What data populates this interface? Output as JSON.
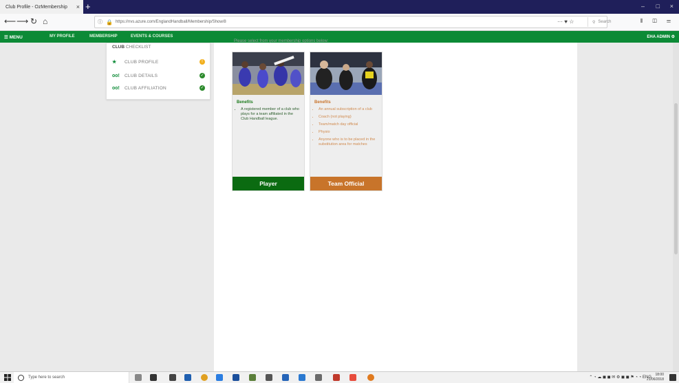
{
  "browser": {
    "tab_title": "Club Profile - OzMembership",
    "tab_close": "×",
    "new_tab": "+",
    "url": "https://nvs.azure.com/EnglandHandball/Membership/Show/8",
    "search_placeholder": "Search",
    "url_actions": "··· ♥ ☆",
    "back": "⟵",
    "forward": "⟶",
    "reload": "↻",
    "home": "⌂",
    "right_tools": "⫴ ◫ ☰",
    "win_min": "–",
    "win_max": "□",
    "win_close": "×"
  },
  "site_menu": {
    "menu_label": "☰ MENU",
    "items": [
      "MY PROFILE",
      "MEMBERSHIP",
      "EVENTS & COURSES"
    ],
    "admin_label": "EHA ADMIN ⚙"
  },
  "checklist": {
    "title_bold": "CLUB",
    "title_rest": " CHECKLIST",
    "rows": [
      {
        "icon": "★",
        "label": "CLUB PROFILE",
        "status": "!"
      },
      {
        "icon": "oo!",
        "label": "CLUB DETAILS",
        "status": "✓"
      },
      {
        "icon": "oo!",
        "label": "CLUB AFFILIATION",
        "status": "✓"
      }
    ]
  },
  "intro_text": "Please select from your membership options below:",
  "cards": [
    {
      "benefits_heading": "Benefits",
      "benefits": [
        "A registered member of a club who plays for a team affiliated in the Club Handball league."
      ],
      "cta": "Player"
    },
    {
      "benefits_heading": "Benefits",
      "benefits": [
        "An annual subscription of a club",
        "Coach (not playing)",
        "Team/match day official",
        "Physio",
        "Anyone who is to be placed in the substitution area for matches"
      ],
      "cta": "Team Official"
    }
  ],
  "taskbar": {
    "search_placeholder": "Type here to search",
    "tray_lang": "ENG",
    "time": "18:00",
    "date": "21/06/2018"
  }
}
